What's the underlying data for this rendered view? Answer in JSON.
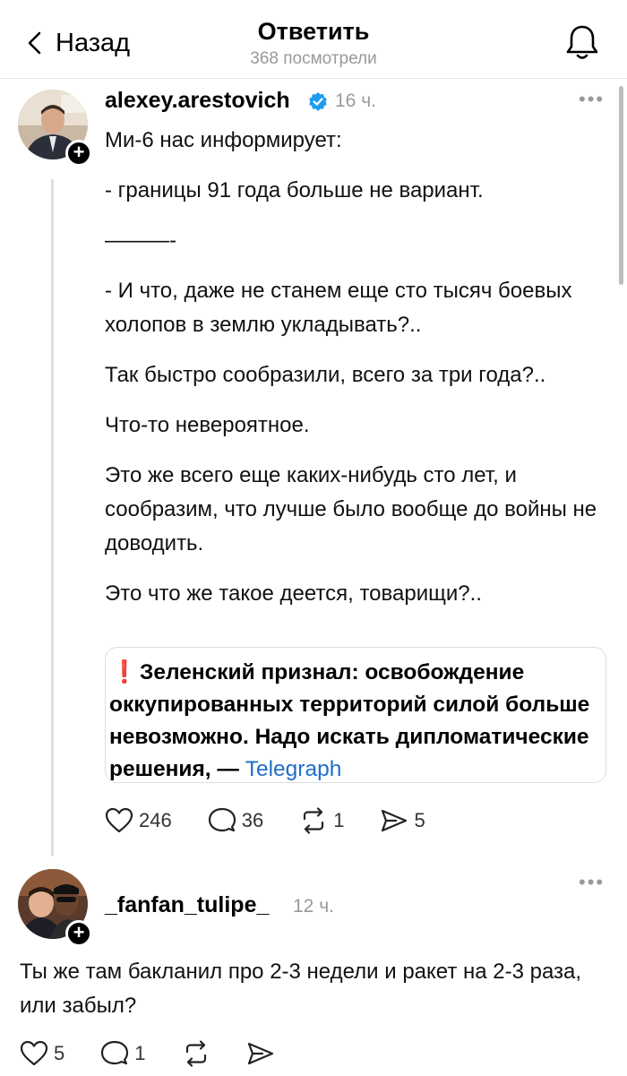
{
  "header": {
    "back_label": "Назад",
    "title": "Ответить",
    "views": "368 посмотрели"
  },
  "post": {
    "username": "alexey.arestovich",
    "time": "16 ч.",
    "paragraphs": [
      "Ми-6 нас информирует:",
      "- границы 91 года больше не вариант.",
      "———-",
      "- И что, даже не станем еще сто тысяч боевых холопов в землю укладывать?..",
      "Так быстро сообразили, всего за три года?..",
      "Что-то невероятное.",
      "Это же всего еще каких-нибудь сто лет, и сообразим, что лучше было вообще до войны не доводить.",
      "Это что же такое деется, товарищи?.."
    ],
    "link_card": {
      "icon": "❗",
      "text": "Зеленский признал: освобождение оккупированных территорий силой больше невозможно. Надо искать дипломатические решения, —",
      "source": "Telegraph"
    },
    "likes": "246",
    "comments": "36",
    "reposts": "1",
    "shares": "5"
  },
  "reply": {
    "username": "_fanfan_tulipe_",
    "time": "12 ч.",
    "text": "Ты же там бакланил про 2-3 недели и ракет на 2-3 раза, или забыл?",
    "likes": "5",
    "comments": "1"
  },
  "colors": {
    "verified": "#1d9bf0",
    "link": "#1f6fc9",
    "alert": "#e5262b",
    "muted": "#999999"
  }
}
